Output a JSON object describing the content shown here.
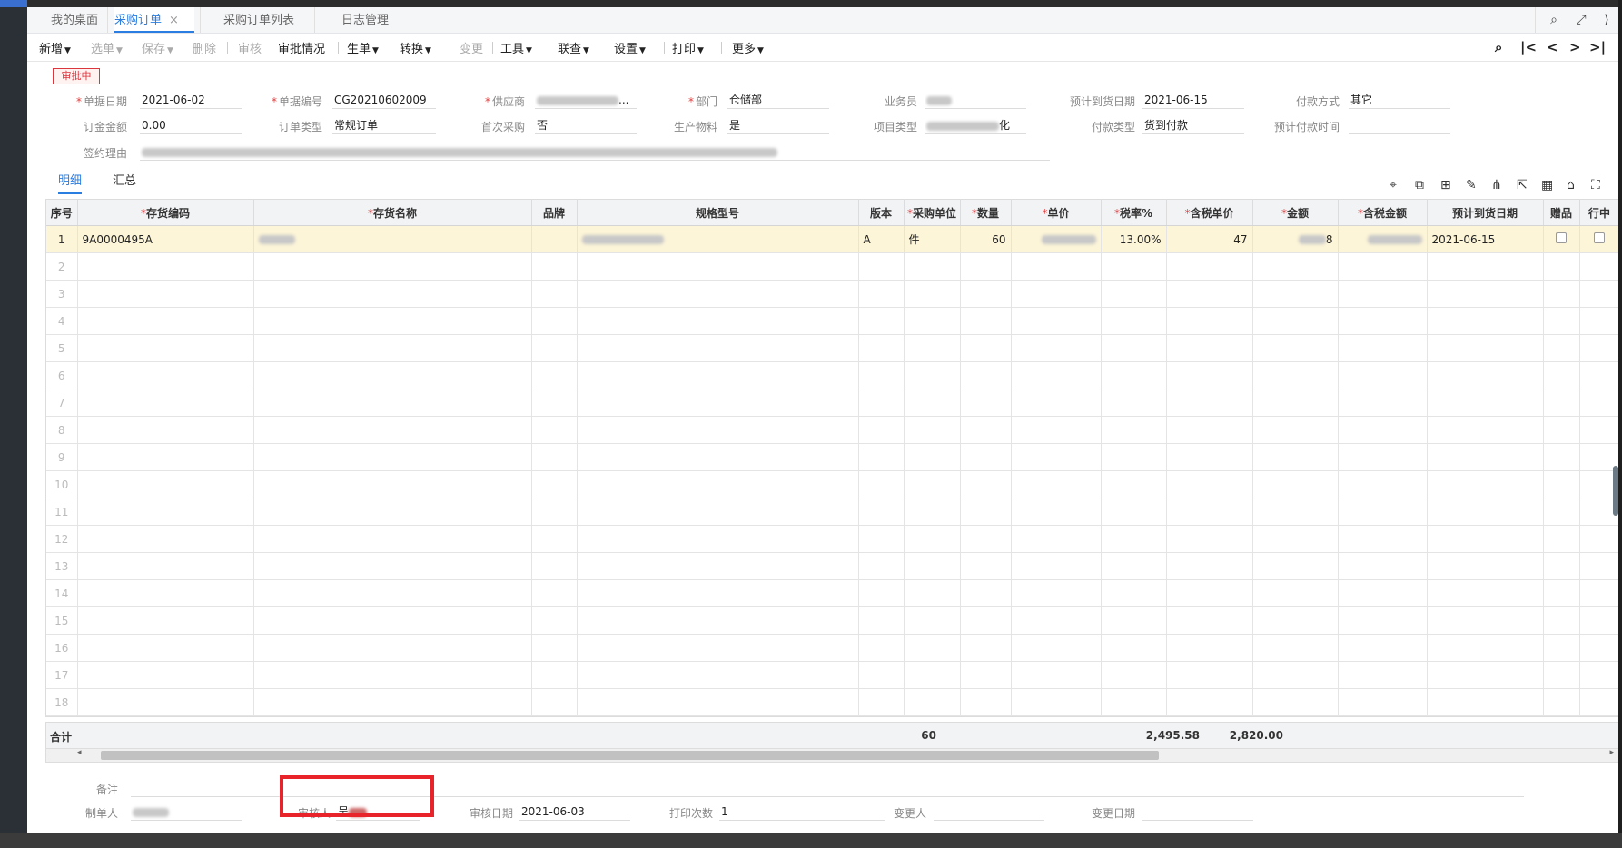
{
  "tabs": [
    {
      "label": "我的桌面",
      "active": false
    },
    {
      "label": "采购订单",
      "active": true,
      "close": "×"
    },
    {
      "label": "采购订单列表",
      "active": false
    },
    {
      "label": "日志管理",
      "active": false
    }
  ],
  "window_icons": [
    "search-icon",
    "maximize-icon",
    "collapse-icon"
  ],
  "toolbar": {
    "new": "新增",
    "select": "选单",
    "save": "保存",
    "delete": "删除",
    "audit": "审核",
    "approval": "审批情况",
    "generate": "生单",
    "convert": "转换",
    "change": "变更",
    "tools": "工具",
    "linked": "联查",
    "settings": "设置",
    "print": "打印",
    "more": "更多"
  },
  "nav_icons": [
    "find-icon",
    "first-icon",
    "prev-icon",
    "next-icon",
    "last-icon"
  ],
  "status": "审批中",
  "form": {
    "doc_date": {
      "label": "单据日期",
      "value": "2021-06-02"
    },
    "doc_no": {
      "label": "单据编号",
      "value": "CG20210602009"
    },
    "supplier": {
      "label": "供应商",
      "value": "..."
    },
    "dept": {
      "label": "部门",
      "value": "仓储部"
    },
    "salesman": {
      "label": "业务员",
      "value": ""
    },
    "expected_arrival": {
      "label": "预计到货日期",
      "value": "2021-06-15"
    },
    "payment_method": {
      "label": "付款方式",
      "value": "其它"
    },
    "deposit": {
      "label": "订金金额",
      "value": "0.00"
    },
    "order_type": {
      "label": "订单类型",
      "value": "常规订单"
    },
    "first_purchase": {
      "label": "首次采购",
      "value": "否"
    },
    "production_material": {
      "label": "生产物料",
      "value": "是"
    },
    "project_type": {
      "label": "项目类型",
      "value": "化"
    },
    "payment_type": {
      "label": "付款类型",
      "value": "货到付款"
    },
    "expected_payment": {
      "label": "预计付款时间",
      "value": ""
    },
    "contract_reason": {
      "label": "签约理由",
      "value": ""
    }
  },
  "inner_tabs": {
    "detail": "明细",
    "summary": "汇总"
  },
  "grid_icons": [
    "location-icon",
    "copy-row-icon",
    "insert-row-icon",
    "edit-icon",
    "split-icon",
    "export-icon",
    "grid-icon",
    "bank-icon",
    "fullscreen-icon"
  ],
  "grid": {
    "columns": [
      "序号",
      "存货编码",
      "存货名称",
      "品牌",
      "规格型号",
      "版本",
      "采购单位",
      "数量",
      "单价",
      "税率%",
      "含税单价",
      "金额",
      "含税金额",
      "预计到货日期",
      "赠品",
      "行中"
    ],
    "row1": {
      "no": "1",
      "code": "9A0000495A",
      "name": "",
      "brand": "",
      "spec": "",
      "version": "A",
      "unit": "件",
      "qty": "60",
      "price": "",
      "tax_rate": "13.00%",
      "tax_price": "47",
      "amount": "8",
      "tax_amount": "",
      "arrival": "2021-06-15"
    },
    "empty_rows": [
      "2",
      "3",
      "4",
      "5",
      "6",
      "7",
      "8",
      "9",
      "10",
      "11",
      "12",
      "13",
      "14",
      "15",
      "16",
      "17",
      "18"
    ]
  },
  "totals": {
    "label": "合计",
    "qty": "60",
    "amount": "2,495.58",
    "tax_amount": "2,820.00"
  },
  "footer": {
    "remark": {
      "label": "备注",
      "value": ""
    },
    "creator": {
      "label": "制单人",
      "value": ""
    },
    "auditor": {
      "label": "审核人",
      "value": "吴"
    },
    "audit_date": {
      "label": "审核日期",
      "value": "2021-06-03"
    },
    "print_count": {
      "label": "打印次数",
      "value": "1"
    },
    "changer": {
      "label": "变更人",
      "value": ""
    },
    "change_date": {
      "label": "变更日期",
      "value": ""
    }
  }
}
